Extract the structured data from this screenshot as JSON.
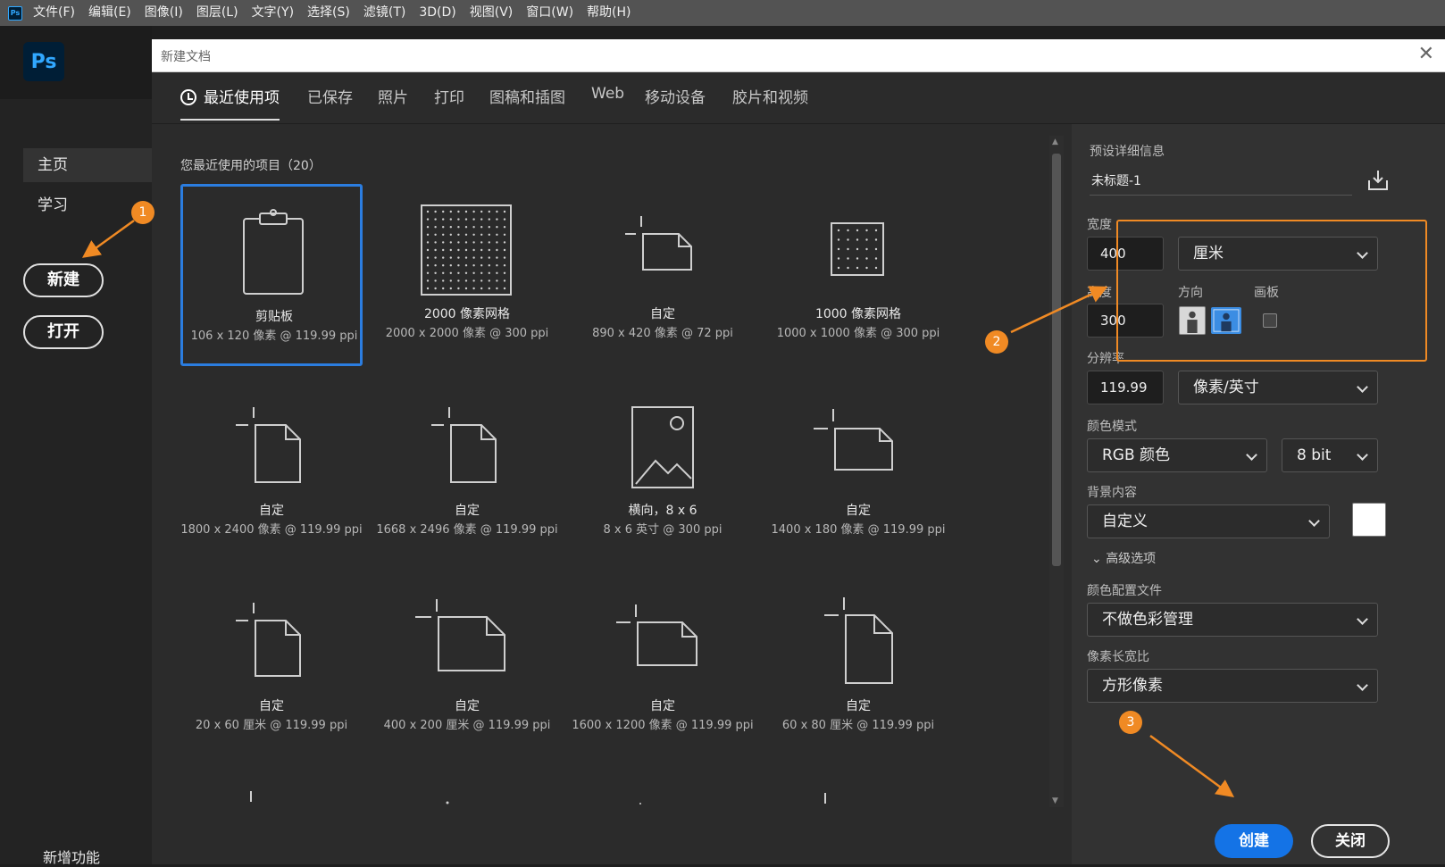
{
  "menubar": {
    "app_icon": "Ps",
    "items": [
      "文件(F)",
      "编辑(E)",
      "图像(I)",
      "图层(L)",
      "文字(Y)",
      "选择(S)",
      "滤镜(T)",
      "3D(D)",
      "视图(V)",
      "窗口(W)",
      "帮助(H)"
    ]
  },
  "left": {
    "logo": "Ps",
    "nav": [
      "主页",
      "学习"
    ],
    "new_label": "新建",
    "open_label": "打开",
    "whats_new": "新增功能"
  },
  "dialog": {
    "title": "新建文档",
    "close_glyph": "✕",
    "tabs": [
      "最近使用项",
      "已保存",
      "照片",
      "打印",
      "图稿和插图",
      "Web",
      "移动设备",
      "胶片和视频"
    ],
    "recent_label": "您最近使用的项目（20）",
    "cards": [
      {
        "name": "剪贴板",
        "dims": "106 x 120 像素 @ 119.99 ppi",
        "icon": "clipboard-icon"
      },
      {
        "name": "2000 像素网格",
        "dims": "2000 x 2000 像素 @ 300 ppi",
        "icon": "grid-icon"
      },
      {
        "name": "自定",
        "dims": "890 x 420 像素 @ 72 ppi",
        "icon": "custom-doc-icon"
      },
      {
        "name": "1000 像素网格",
        "dims": "1000 x 1000 像素 @ 300 ppi",
        "icon": "grid-icon"
      },
      {
        "name": "自定",
        "dims": "1800 x 2400 像素 @ 119.99 ppi",
        "icon": "custom-doc-icon"
      },
      {
        "name": "自定",
        "dims": "1668 x 2496 像素 @ 119.99 ppi",
        "icon": "custom-doc-icon"
      },
      {
        "name": "横向，8 x 6",
        "dims": "8 x 6 英寸 @ 300 ppi",
        "icon": "photo-icon"
      },
      {
        "name": "自定",
        "dims": "1400 x 180 像素 @ 119.99 ppi",
        "icon": "custom-doc-icon"
      },
      {
        "name": "自定",
        "dims": "20 x 60 厘米 @ 119.99 ppi",
        "icon": "custom-doc-icon"
      },
      {
        "name": "自定",
        "dims": "400 x 200 厘米 @ 119.99 ppi",
        "icon": "custom-doc-icon"
      },
      {
        "name": "自定",
        "dims": "1600 x 1200 像素 @ 119.99 ppi",
        "icon": "custom-doc-icon"
      },
      {
        "name": "自定",
        "dims": "60 x 80 厘米 @ 119.99 ppi",
        "icon": "custom-doc-icon"
      }
    ]
  },
  "details": {
    "title": "预设详细信息",
    "doc_name": "未标题-1",
    "width_label": "宽度",
    "width_value": "400",
    "width_unit": "厘米",
    "height_label": "高度",
    "height_value": "300",
    "orientation_label": "方向",
    "artboard_label": "画板",
    "resolution_label": "分辨率",
    "resolution_value": "119.99",
    "resolution_unit": "像素/英寸",
    "color_mode_label": "颜色模式",
    "color_mode": "RGB 颜色",
    "bit_depth": "8 bit",
    "background_label": "背景内容",
    "background": "自定义",
    "advanced": "高级选项",
    "profile_label": "颜色配置文件",
    "profile": "不做色彩管理",
    "aspect_label": "像素长宽比",
    "aspect": "方形像素",
    "create": "创建",
    "close": "关闭"
  },
  "annotations": {
    "badge1": "1",
    "badge2": "2",
    "badge3": "3",
    "color": "#f08a24"
  }
}
